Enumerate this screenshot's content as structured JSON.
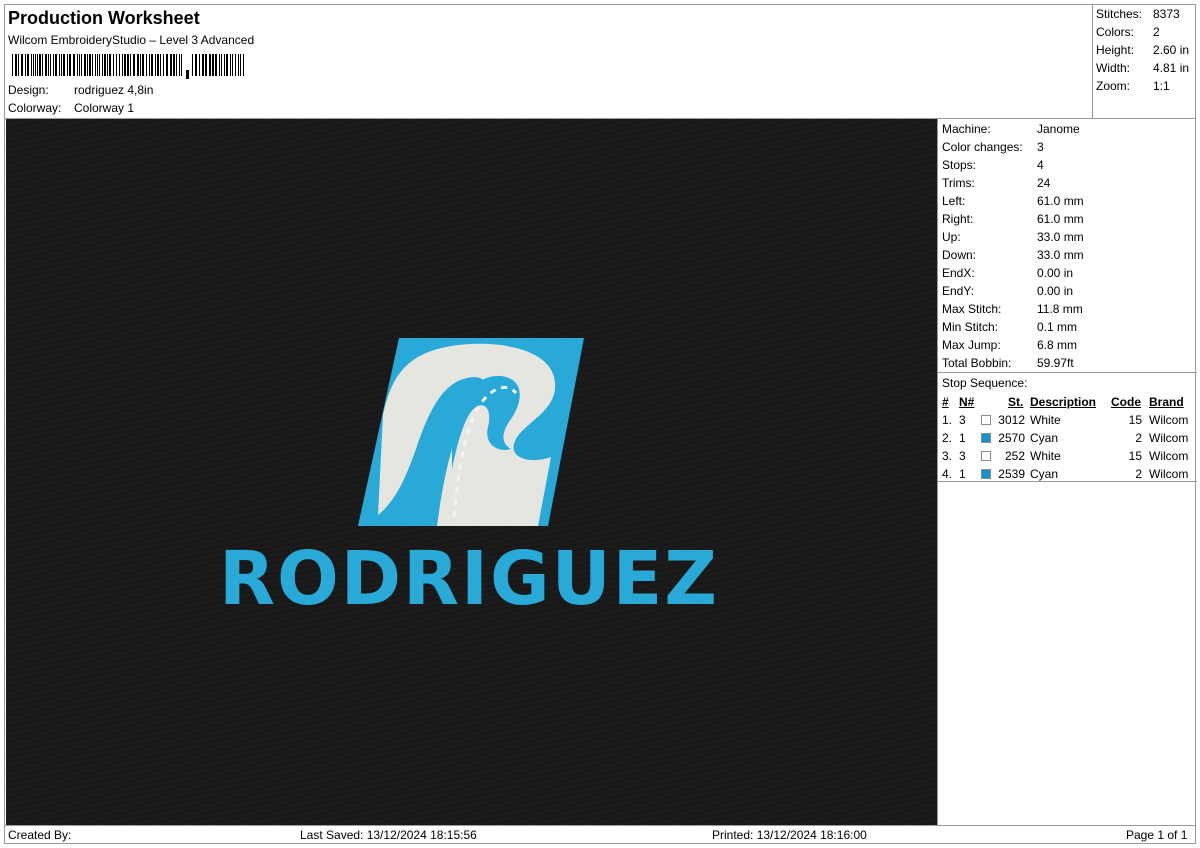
{
  "header": {
    "title": "Production Worksheet",
    "subtitle": "Wilcom EmbroideryStudio – Level 3 Advanced",
    "design_label": "Design:",
    "design_value": "rodriguez 4,8in",
    "colorway_label": "Colorway:",
    "colorway_value": "Colorway 1"
  },
  "summary": [
    {
      "label": "Stitches:",
      "value": "8373"
    },
    {
      "label": "Colors:",
      "value": "2"
    },
    {
      "label": "Height:",
      "value": "2.60 in"
    },
    {
      "label": "Width:",
      "value": "4.81 in"
    },
    {
      "label": "Zoom:",
      "value": "1:1"
    }
  ],
  "preview": {
    "logo_text": "RODRIGUEZ",
    "background_color": "#181818",
    "accent_color": "#29a9d8",
    "road_color": "#e6e6e0"
  },
  "machine_params": [
    {
      "label": "Machine:",
      "value": "Janome"
    },
    {
      "label": "Color changes:",
      "value": "3"
    },
    {
      "label": "Stops:",
      "value": "4"
    },
    {
      "label": "Trims:",
      "value": "24"
    },
    {
      "label": "Left:",
      "value": "61.0 mm"
    },
    {
      "label": "Right:",
      "value": "61.0 mm"
    },
    {
      "label": "Up:",
      "value": "33.0 mm"
    },
    {
      "label": "Down:",
      "value": "33.0 mm"
    },
    {
      "label": "EndX:",
      "value": "0.00 in"
    },
    {
      "label": "EndY:",
      "value": "0.00 in"
    },
    {
      "label": "Max Stitch:",
      "value": "11.8 mm"
    },
    {
      "label": "Min Stitch:",
      "value": "0.1 mm"
    },
    {
      "label": "Max Jump:",
      "value": "6.8 mm"
    },
    {
      "label": "Total Bobbin:",
      "value": "59.97ft"
    }
  ],
  "stop_sequence": {
    "title": "Stop Sequence:",
    "headers": {
      "num": "#",
      "n": "N#",
      "st": "St.",
      "description": "Description",
      "code": "Code",
      "brand": "Brand"
    },
    "rows": [
      {
        "num": "1.",
        "n": "3",
        "swatch": "#ffffff",
        "st": "3012",
        "description": "White",
        "code": "15",
        "brand": "Wilcom"
      },
      {
        "num": "2.",
        "n": "1",
        "swatch": "#1a8fd6",
        "st": "2570",
        "description": "Cyan",
        "code": "2",
        "brand": "Wilcom"
      },
      {
        "num": "3.",
        "n": "3",
        "swatch": "#ffffff",
        "st": "252",
        "description": "White",
        "code": "15",
        "brand": "Wilcom"
      },
      {
        "num": "4.",
        "n": "1",
        "swatch": "#1a8fd6",
        "st": "2539",
        "description": "Cyan",
        "code": "2",
        "brand": "Wilcom"
      }
    ]
  },
  "footer": {
    "created_by": "Created By:",
    "last_saved": "Last Saved: 13/12/2024 18:15:56",
    "printed": "Printed: 13/12/2024 18:16:00",
    "page": "Page 1 of 1"
  }
}
